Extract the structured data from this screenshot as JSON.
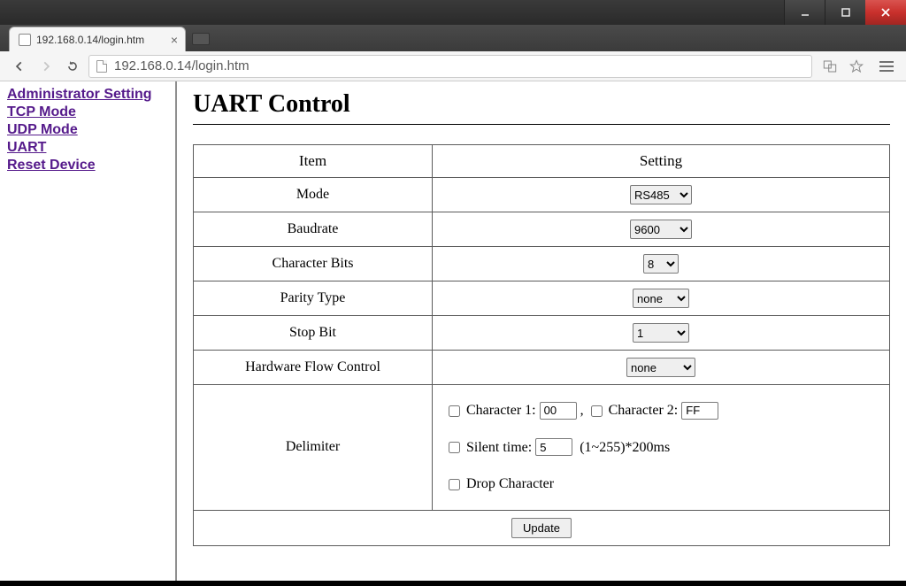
{
  "browser": {
    "tab_title": "192.168.0.14/login.htm",
    "url": "192.168.0.14/login.htm"
  },
  "sidebar": {
    "items": [
      "Administrator Setting",
      "TCP Mode",
      "UDP Mode",
      "UART",
      "Reset Device"
    ]
  },
  "page": {
    "title": "UART Control",
    "headers": {
      "item": "Item",
      "setting": "Setting"
    },
    "rows": {
      "mode": {
        "label": "Mode",
        "value": "RS485"
      },
      "baud": {
        "label": "Baudrate",
        "value": "9600"
      },
      "bits": {
        "label": "Character Bits",
        "value": "8"
      },
      "parity": {
        "label": "Parity Type",
        "value": "none"
      },
      "stop": {
        "label": "Stop Bit",
        "value": "1"
      },
      "flow": {
        "label": "Hardware Flow Control",
        "value": "none"
      },
      "delimiter": {
        "label": "Delimiter",
        "char1_label": "Character 1:",
        "char1_value": "00",
        "comma": " , ",
        "char2_label": "Character 2:",
        "char2_value": "FF",
        "silent_label": "Silent time:",
        "silent_value": "5",
        "silent_hint": "(1~255)*200ms",
        "drop_label": "Drop Character"
      }
    },
    "update_label": "Update"
  }
}
